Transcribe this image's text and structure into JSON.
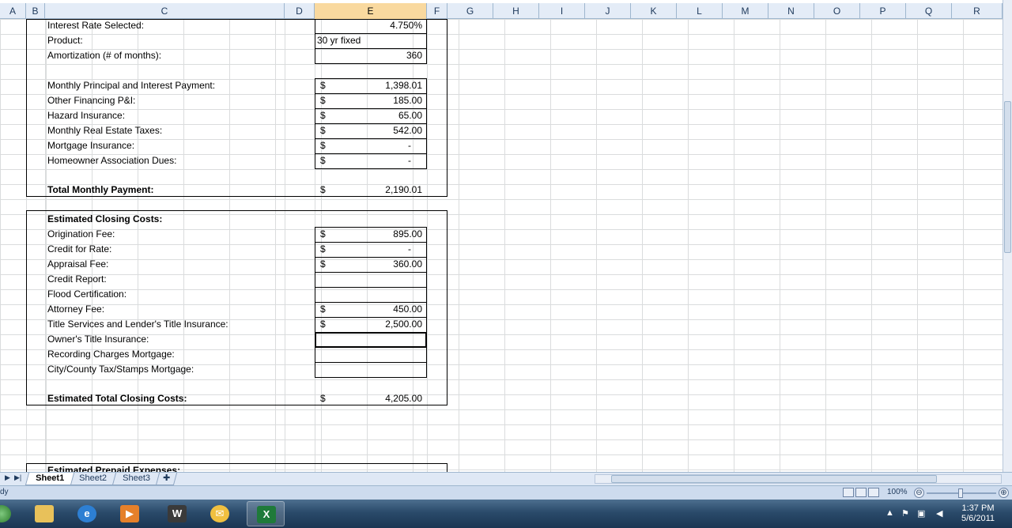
{
  "columns": [
    "A",
    "B",
    "C",
    "D",
    "E",
    "F",
    "G",
    "H",
    "I",
    "J",
    "K",
    "L",
    "M",
    "N",
    "O",
    "P",
    "Q",
    "R"
  ],
  "selected_column": "E",
  "rows": [
    {
      "label": "Interest Rate Selected:",
      "currency": "",
      "value": "4.750%"
    },
    {
      "label": "Product:",
      "currency": "",
      "text": "30 yr fixed"
    },
    {
      "label": "Amortization (# of months):",
      "currency": "",
      "value": "360"
    },
    {
      "label": "Monthly Principal and Interest Payment:",
      "currency": "$",
      "value": "1,398.01"
    },
    {
      "label": "Other Financing P&I:",
      "currency": "$",
      "value": "185.00"
    },
    {
      "label": "Hazard Insurance:",
      "currency": "$",
      "value": "65.00"
    },
    {
      "label": "Monthly Real Estate Taxes:",
      "currency": "$",
      "value": "542.00"
    },
    {
      "label": "Mortgage Insurance:",
      "currency": "$",
      "value": "-"
    },
    {
      "label": "Homeowner Association Dues:",
      "currency": "$",
      "value": "-"
    },
    {
      "label": "Total Monthly Payment:",
      "currency": "$",
      "value": "2,190.01"
    },
    {
      "label": "Estimated Closing Costs:"
    },
    {
      "label": "Origination Fee:",
      "currency": "$",
      "value": "895.00"
    },
    {
      "label": "Credit for Rate:",
      "currency": "$",
      "value": "-"
    },
    {
      "label": "Appraisal Fee:",
      "currency": "$",
      "value": "360.00"
    },
    {
      "label": "Credit Report:"
    },
    {
      "label": "Flood Certification:"
    },
    {
      "label": "Attorney Fee:",
      "currency": "$",
      "value": "450.00"
    },
    {
      "label": "Title Services and Lender's Title Insurance:",
      "currency": "$",
      "value": "2,500.00"
    },
    {
      "label": "Owner's Title Insurance:"
    },
    {
      "label": "Recording Charges Mortgage:"
    },
    {
      "label": "City/County Tax/Stamps Mortgage:"
    },
    {
      "label": "Estimated Total Closing Costs:",
      "currency": "$",
      "value": "4,205.00"
    },
    {
      "label": "Estimated Prepaid Expenses:"
    }
  ],
  "sheet_tabs": [
    "Sheet1",
    "Sheet2",
    "Sheet3"
  ],
  "active_sheet": "Sheet1",
  "status": {
    "mode": "dy",
    "zoom": "100%",
    "zoom_minus": "⊖",
    "zoom_plus": "⊕"
  },
  "taskbar": {
    "apps": [
      "Windows Explorer",
      "Internet Explorer",
      "Media Player",
      "Application",
      "Outlook",
      "Excel"
    ],
    "time": "1:37 PM",
    "date": "5/6/2011"
  }
}
